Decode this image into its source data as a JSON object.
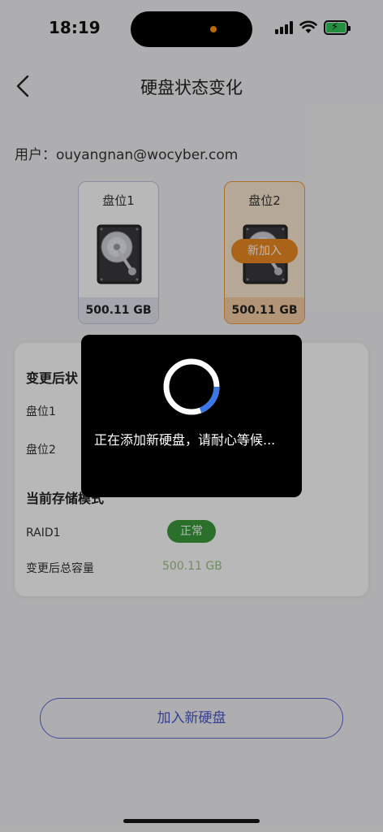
{
  "status_bar": {
    "time": "18:19"
  },
  "nav": {
    "title": "硬盘状态变化"
  },
  "user": {
    "label": "用户：",
    "email": "ouyangnan@wocyber.com"
  },
  "slots": [
    {
      "label": "盘位1",
      "capacity": "500.11 GB"
    },
    {
      "label": "盘位2",
      "capacity": "500.11 GB",
      "badge": "新加入"
    }
  ],
  "card": {
    "section1_title": "变更后状",
    "row1_label": "盘位1",
    "row2_label": "盘位2",
    "section2_title": "当前存储模式",
    "mode_label": "RAID1",
    "mode_status": "正常",
    "capacity_label": "变更后总容量",
    "capacity_value": "500.11 GB"
  },
  "add_button": {
    "label": "加入新硬盘"
  },
  "toast": {
    "message": "正在添加新硬盘，请耐心等候..."
  },
  "colors": {
    "accent": "#4a58cc",
    "new_badge": "#ee8a22",
    "ok_status": "#3b9a3b",
    "spinner_progress": "#3a78e8"
  }
}
